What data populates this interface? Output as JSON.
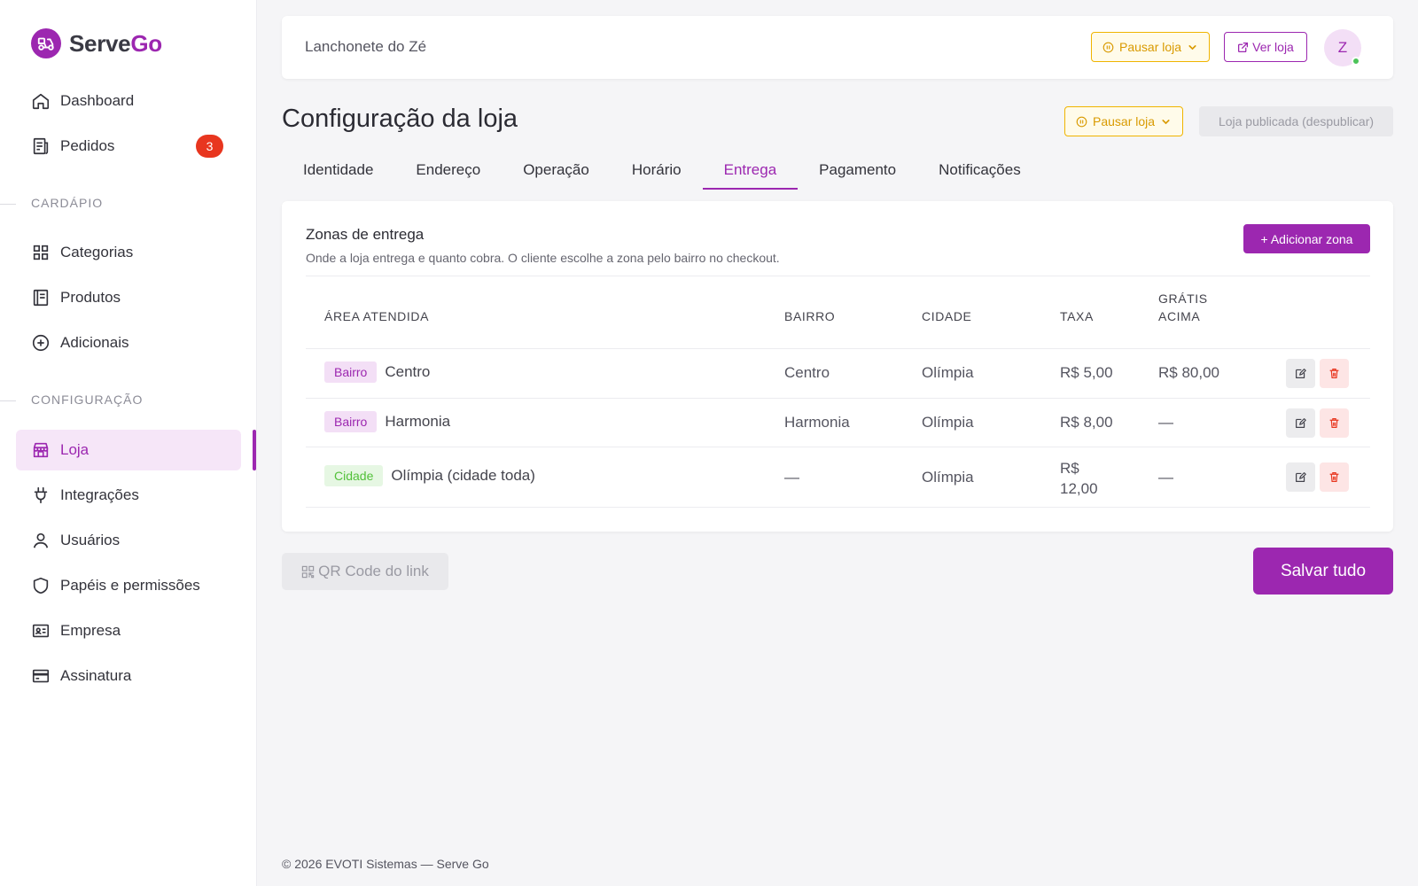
{
  "brand": {
    "name_part1": "Serve",
    "name_part2": "Go"
  },
  "sidebar": {
    "items": [
      {
        "label": "Dashboard"
      },
      {
        "label": "Pedidos",
        "badge": "3"
      }
    ],
    "section_cardapio": "CARDÁPIO",
    "cardapio_items": [
      {
        "label": "Categorias"
      },
      {
        "label": "Produtos"
      },
      {
        "label": "Adicionais"
      }
    ],
    "section_config": "CONFIGURAÇÃO",
    "config_items": [
      {
        "label": "Loja",
        "active": true
      },
      {
        "label": "Integrações"
      },
      {
        "label": "Usuários"
      },
      {
        "label": "Papéis e permissões"
      },
      {
        "label": "Empresa"
      },
      {
        "label": "Assinatura"
      }
    ]
  },
  "topbar": {
    "store_name": "Lanchonete do Zé",
    "pause_label": "Pausar loja",
    "view_label": "Ver loja",
    "avatar_initial": "Z"
  },
  "page": {
    "title": "Configuração da loja",
    "pause_label": "Pausar loja",
    "published_label": "Loja publicada (despublicar)"
  },
  "tabs": [
    {
      "label": "Identidade"
    },
    {
      "label": "Endereço"
    },
    {
      "label": "Operação"
    },
    {
      "label": "Horário"
    },
    {
      "label": "Entrega",
      "active": true
    },
    {
      "label": "Pagamento"
    },
    {
      "label": "Notificações"
    }
  ],
  "zones": {
    "title": "Zonas de entrega",
    "subtitle": "Onde a loja entrega e quanto cobra. O cliente escolhe a zona pelo bairro no checkout.",
    "add_label": "+ Adicionar zona",
    "headers": {
      "area": "ÁREA ATENDIDA",
      "bairro": "BAIRRO",
      "cidade": "CIDADE",
      "taxa": "TAXA",
      "gratis_1": "GRÁTIS",
      "gratis_2": "ACIMA"
    },
    "rows": [
      {
        "tag": "Bairro",
        "area": "Centro",
        "bairro": "Centro",
        "cidade": "Olímpia",
        "taxa": "R$ 5,00",
        "gratis": "R$ 80,00"
      },
      {
        "tag": "Bairro",
        "area": "Harmonia",
        "bairro": "Harmonia",
        "cidade": "Olímpia",
        "taxa": "R$ 8,00",
        "gratis": "—"
      },
      {
        "tag": "Cidade",
        "area": "Olímpia (cidade toda)",
        "bairro": "—",
        "cidade": "Olímpia",
        "taxa_1": "R$",
        "taxa_2": "12,00",
        "gratis": "—"
      }
    ]
  },
  "actions": {
    "qr_label": "QR Code do link",
    "save_label": "Salvar tudo"
  },
  "footer": "© 2026 EVOTI Sistemas — Serve Go",
  "colors": {
    "accent": "#9c27b0",
    "warning": "#f0b400",
    "danger": "#e8361f",
    "success": "#4cc35a"
  }
}
